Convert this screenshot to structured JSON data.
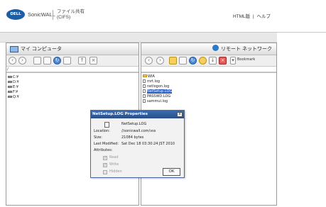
{
  "header": {
    "logo_text": "DELL",
    "brand": "SonicWALL",
    "app_title_line1": "ファイル共有",
    "app_title_line2": "(CIFS)",
    "nav_html": "HTML版",
    "nav_sep": "|",
    "nav_help": "ヘルプ"
  },
  "left_panel": {
    "title": "マイ コンピュータ",
    "path": "/",
    "drives": [
      "C:¥",
      "D:¥",
      "E:¥",
      "F:¥",
      "Q:¥"
    ]
  },
  "right_panel": {
    "title": "リモート ネットワーク",
    "bookmark_label": "Bookmark",
    "files": [
      {
        "name": "WIA",
        "type": "folder"
      },
      {
        "name": "mrt.log",
        "type": "file"
      },
      {
        "name": "netlogon.log",
        "type": "file"
      },
      {
        "name": "NetSetup.LOG",
        "type": "file",
        "selected": true
      },
      {
        "name": "PASSWD.LOG",
        "type": "file"
      },
      {
        "name": "sammui.log",
        "type": "file"
      }
    ]
  },
  "dialog": {
    "title": "NetSetup.LOG Properties",
    "close": "x",
    "filename": "NetSetup.LOG",
    "location_label": "Location:",
    "location_value": "//sonicwall.com/vss",
    "size_label": "Size:",
    "size_value": "21084 bytes",
    "modified_label": "Last Modified:",
    "modified_value": "Sat Dec 18 03:30:24 JST 2010",
    "attributes_label": "Attributes:",
    "attributes": [
      {
        "label": "Read",
        "checked": true
      },
      {
        "label": "Write",
        "checked": true
      },
      {
        "label": "Hidden",
        "checked": false
      }
    ],
    "ok_label": "OK"
  },
  "colors": {
    "accent": "#2c5fc1",
    "dialog_title": "#2a4f8a",
    "logo": "#1a5ea8"
  }
}
